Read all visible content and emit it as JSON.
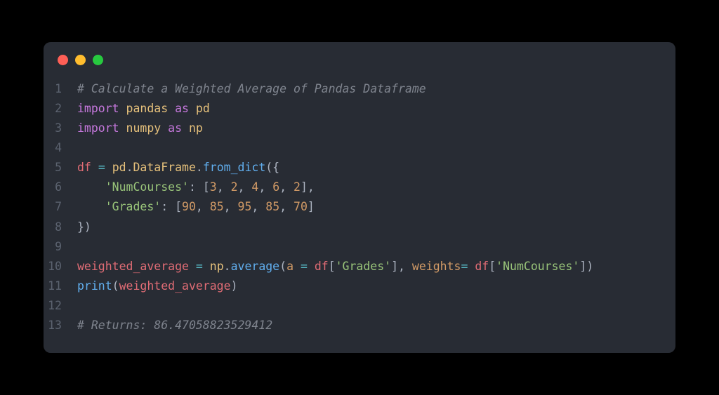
{
  "window": {
    "traffic_lights": [
      "red",
      "yellow",
      "green"
    ]
  },
  "code": {
    "lines": [
      {
        "num": "1",
        "tokens": [
          {
            "cls": "comment",
            "text": "# Calculate a Weighted Average of Pandas Dataframe"
          }
        ]
      },
      {
        "num": "2",
        "tokens": [
          {
            "cls": "keyword",
            "text": "import"
          },
          {
            "cls": "punc",
            "text": " "
          },
          {
            "cls": "module",
            "text": "pandas"
          },
          {
            "cls": "punc",
            "text": " "
          },
          {
            "cls": "keyword",
            "text": "as"
          },
          {
            "cls": "punc",
            "text": " "
          },
          {
            "cls": "module",
            "text": "pd"
          }
        ]
      },
      {
        "num": "3",
        "tokens": [
          {
            "cls": "keyword",
            "text": "import"
          },
          {
            "cls": "punc",
            "text": " "
          },
          {
            "cls": "module",
            "text": "numpy"
          },
          {
            "cls": "punc",
            "text": " "
          },
          {
            "cls": "keyword",
            "text": "as"
          },
          {
            "cls": "punc",
            "text": " "
          },
          {
            "cls": "module",
            "text": "np"
          }
        ]
      },
      {
        "num": "4",
        "tokens": []
      },
      {
        "num": "5",
        "tokens": [
          {
            "cls": "variable",
            "text": "df"
          },
          {
            "cls": "punc",
            "text": " "
          },
          {
            "cls": "operator",
            "text": "="
          },
          {
            "cls": "punc",
            "text": " "
          },
          {
            "cls": "module",
            "text": "pd"
          },
          {
            "cls": "punc",
            "text": "."
          },
          {
            "cls": "module",
            "text": "DataFrame"
          },
          {
            "cls": "punc",
            "text": "."
          },
          {
            "cls": "function",
            "text": "from_dict"
          },
          {
            "cls": "paren",
            "text": "({"
          }
        ]
      },
      {
        "num": "6",
        "tokens": [
          {
            "cls": "punc",
            "text": "    "
          },
          {
            "cls": "string",
            "text": "'NumCourses'"
          },
          {
            "cls": "punc",
            "text": ": ["
          },
          {
            "cls": "number",
            "text": "3"
          },
          {
            "cls": "punc",
            "text": ", "
          },
          {
            "cls": "number",
            "text": "2"
          },
          {
            "cls": "punc",
            "text": ", "
          },
          {
            "cls": "number",
            "text": "4"
          },
          {
            "cls": "punc",
            "text": ", "
          },
          {
            "cls": "number",
            "text": "6"
          },
          {
            "cls": "punc",
            "text": ", "
          },
          {
            "cls": "number",
            "text": "2"
          },
          {
            "cls": "punc",
            "text": "],"
          }
        ]
      },
      {
        "num": "7",
        "tokens": [
          {
            "cls": "punc",
            "text": "    "
          },
          {
            "cls": "string",
            "text": "'Grades'"
          },
          {
            "cls": "punc",
            "text": ": ["
          },
          {
            "cls": "number",
            "text": "90"
          },
          {
            "cls": "punc",
            "text": ", "
          },
          {
            "cls": "number",
            "text": "85"
          },
          {
            "cls": "punc",
            "text": ", "
          },
          {
            "cls": "number",
            "text": "95"
          },
          {
            "cls": "punc",
            "text": ", "
          },
          {
            "cls": "number",
            "text": "85"
          },
          {
            "cls": "punc",
            "text": ", "
          },
          {
            "cls": "number",
            "text": "70"
          },
          {
            "cls": "punc",
            "text": "]"
          }
        ]
      },
      {
        "num": "8",
        "tokens": [
          {
            "cls": "paren",
            "text": "})"
          }
        ]
      },
      {
        "num": "9",
        "tokens": []
      },
      {
        "num": "10",
        "tokens": [
          {
            "cls": "variable",
            "text": "weighted_average"
          },
          {
            "cls": "punc",
            "text": " "
          },
          {
            "cls": "operator",
            "text": "="
          },
          {
            "cls": "punc",
            "text": " "
          },
          {
            "cls": "module",
            "text": "np"
          },
          {
            "cls": "punc",
            "text": "."
          },
          {
            "cls": "function",
            "text": "average"
          },
          {
            "cls": "paren",
            "text": "("
          },
          {
            "cls": "param",
            "text": "a"
          },
          {
            "cls": "punc",
            "text": " "
          },
          {
            "cls": "operator",
            "text": "="
          },
          {
            "cls": "punc",
            "text": " "
          },
          {
            "cls": "variable",
            "text": "df"
          },
          {
            "cls": "punc",
            "text": "["
          },
          {
            "cls": "string",
            "text": "'Grades'"
          },
          {
            "cls": "punc",
            "text": "], "
          },
          {
            "cls": "param",
            "text": "weights"
          },
          {
            "cls": "operator",
            "text": "="
          },
          {
            "cls": "punc",
            "text": " "
          },
          {
            "cls": "variable",
            "text": "df"
          },
          {
            "cls": "punc",
            "text": "["
          },
          {
            "cls": "string",
            "text": "'NumCourses'"
          },
          {
            "cls": "punc",
            "text": "]"
          },
          {
            "cls": "paren",
            "text": ")"
          }
        ]
      },
      {
        "num": "11",
        "tokens": [
          {
            "cls": "function",
            "text": "print"
          },
          {
            "cls": "paren",
            "text": "("
          },
          {
            "cls": "variable",
            "text": "weighted_average"
          },
          {
            "cls": "paren",
            "text": ")"
          }
        ]
      },
      {
        "num": "12",
        "tokens": []
      },
      {
        "num": "13",
        "tokens": [
          {
            "cls": "comment",
            "text": "# Returns: 86.47058823529412"
          }
        ]
      }
    ]
  }
}
